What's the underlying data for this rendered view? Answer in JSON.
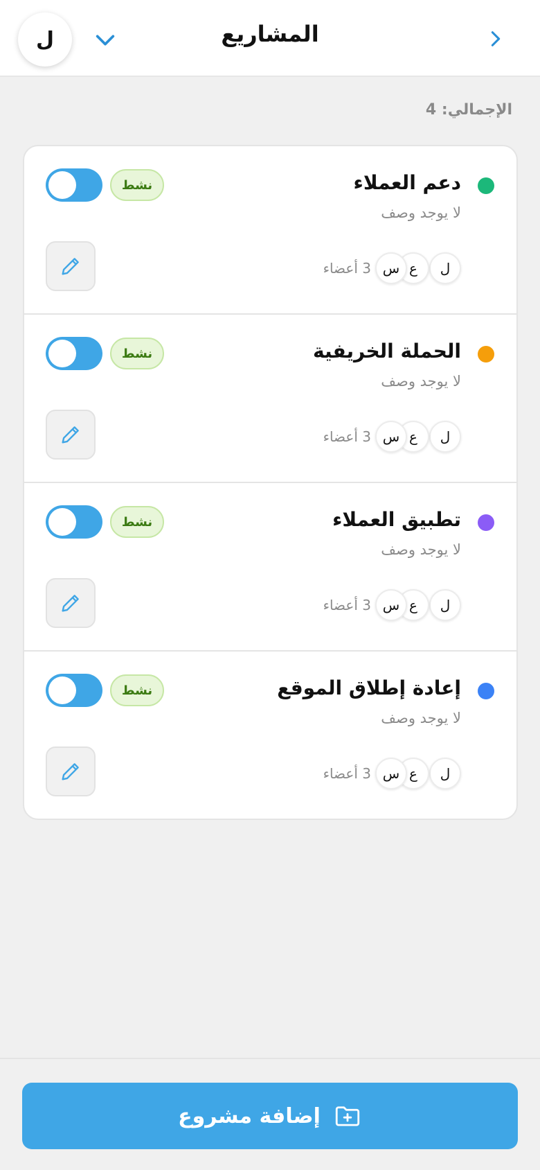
{
  "header": {
    "title": "المشاريع",
    "avatar_initial": "ل"
  },
  "summary": {
    "total_label": "الإجمالي: 4"
  },
  "projects": [
    {
      "name": "دعم العملاء",
      "description": "لا يوجد وصف",
      "status": "نشط",
      "color": "#1cb87a",
      "members": [
        "ل",
        "ع",
        "س"
      ],
      "members_count_label": "3 أعضاء"
    },
    {
      "name": "الحملة الخريفية",
      "description": "لا يوجد وصف",
      "status": "نشط",
      "color": "#f59e0b",
      "members": [
        "ل",
        "ع",
        "س"
      ],
      "members_count_label": "3 أعضاء"
    },
    {
      "name": "تطبيق العملاء",
      "description": "لا يوجد وصف",
      "status": "نشط",
      "color": "#8b5cf6",
      "members": [
        "ل",
        "ع",
        "س"
      ],
      "members_count_label": "3 أعضاء"
    },
    {
      "name": "إعادة إطلاق الموقع",
      "description": "لا يوجد وصف",
      "status": "نشط",
      "color": "#3b82f6",
      "members": [
        "ل",
        "ع",
        "س"
      ],
      "members_count_label": "3 أعضاء"
    }
  ],
  "footer": {
    "add_button_label": "إضافة مشروع"
  },
  "theme": {
    "accent": "#3fa6e6",
    "badge_bg": "#e8f6d9",
    "badge_text": "#3b7a12"
  },
  "icons": {
    "back": "chevron-right-icon",
    "dropdown": "chevron-down-icon",
    "edit": "pencil-icon",
    "add": "folder-plus-icon"
  }
}
